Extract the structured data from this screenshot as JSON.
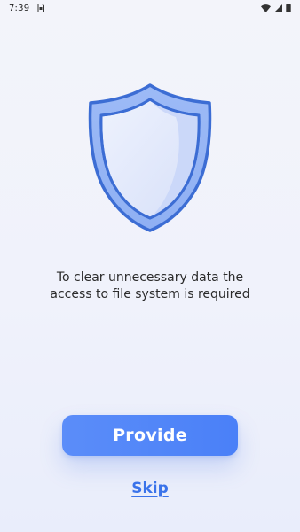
{
  "status_bar": {
    "time": "7:39",
    "icons": [
      "sim-card-icon",
      "wifi-icon",
      "cellular-signal-icon",
      "battery-icon"
    ]
  },
  "hero": {
    "icon": "shield-icon"
  },
  "message": {
    "line1": "To clear unnecessary data the",
    "line2": "access to file system is required"
  },
  "actions": {
    "provide_label": "Provide",
    "skip_label": "Skip"
  },
  "colors": {
    "accent": "#4a80f8",
    "link": "#3a73ea",
    "shield_outline": "#3d6fd6",
    "shield_fill": "#dfe6fb"
  }
}
